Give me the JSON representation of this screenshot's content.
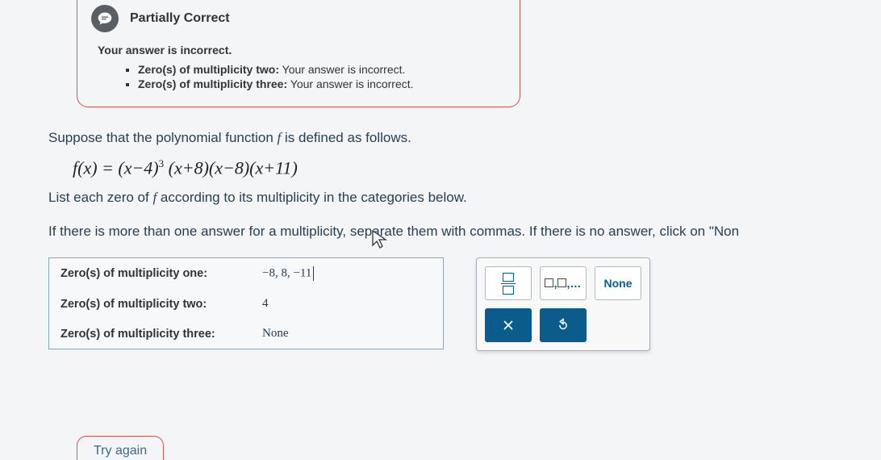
{
  "feedback": {
    "title": "Partially Correct",
    "subtitle": "Your answer is incorrect.",
    "items": [
      {
        "label": "Zero(s) of multiplicity two:",
        "msg": "Your answer is incorrect."
      },
      {
        "label": "Zero(s) of multiplicity three:",
        "msg": "Your answer is incorrect."
      }
    ]
  },
  "problem": {
    "line1_a": "Suppose that the polynomial function ",
    "line1_b": " is defined as follows.",
    "formula": "f(x) = (x−4)³ (x+8)(x−8)(x+11)",
    "line2_a": "List each zero of ",
    "line2_b": " according to its multiplicity in the categories below.",
    "line3": "If there is more than one answer for a multiplicity, separate them with commas. If there is no answer, click on \"Non"
  },
  "answers": {
    "rows": [
      {
        "label": "Zero(s) of multiplicity one:",
        "value": "−8, 8, −11"
      },
      {
        "label": "Zero(s) of multiplicity two:",
        "value": "4"
      },
      {
        "label": "Zero(s) of multiplicity three:",
        "value": "None"
      }
    ]
  },
  "palette": {
    "none_label": "None"
  },
  "try_again": "Try again"
}
